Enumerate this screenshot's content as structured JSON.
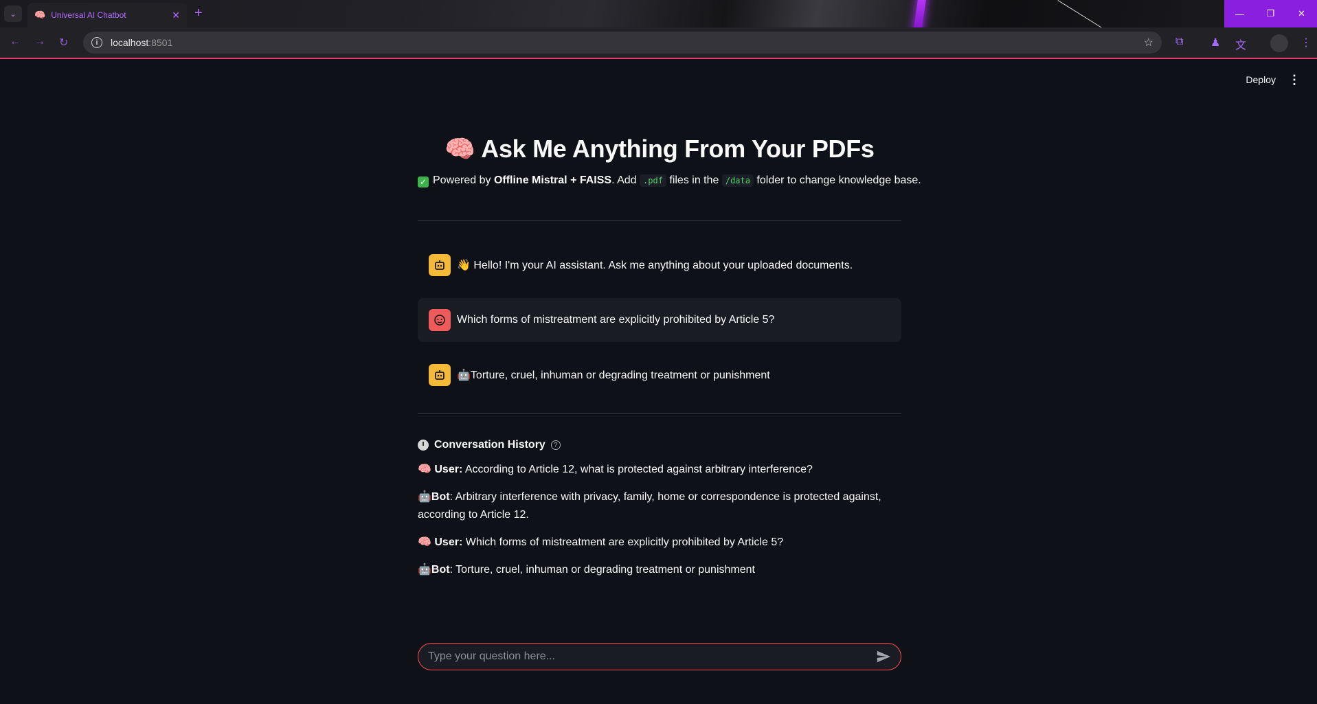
{
  "browser": {
    "tab_title": "Universal AI Chatbot",
    "url_host": "localhost",
    "url_port": ":8501"
  },
  "app": {
    "deploy_label": "Deploy",
    "title_emoji": "🧠",
    "title": "Ask Me Anything From Your PDFs",
    "subtitle": {
      "prefix": "Powered by ",
      "model": "Offline Mistral + FAISS",
      "mid1": ". Add ",
      "code1": ".pdf",
      "mid2": " files in the ",
      "code2": "/data",
      "suffix": " folder to change knowledge base."
    },
    "messages": [
      {
        "role": "assistant",
        "text": "👋 Hello! I'm your AI assistant. Ask me anything about your uploaded documents."
      },
      {
        "role": "user",
        "text": "Which forms of mistreatment are explicitly prohibited by Article 5?"
      },
      {
        "role": "assistant",
        "text": "🤖Torture, cruel, inhuman or degrading treatment or punishment"
      }
    ],
    "history": {
      "title": "Conversation History",
      "entries": [
        {
          "icon": "🧠",
          "speaker": "User:",
          "text": " According to Article 12, what is protected against arbitrary interference?"
        },
        {
          "icon": "🤖",
          "speaker": "Bot",
          "text": ": Arbitrary interference with privacy, family, home or correspondence is protected against, according to Article 12."
        },
        {
          "icon": "🧠",
          "speaker": "User:",
          "text": " Which forms of mistreatment are explicitly prohibited by Article 5?"
        },
        {
          "icon": "🤖",
          "speaker": "Bot",
          "text": ": Torture, cruel, inhuman or degrading treatment or punishment"
        }
      ]
    },
    "input": {
      "placeholder": "Type your question here..."
    }
  }
}
